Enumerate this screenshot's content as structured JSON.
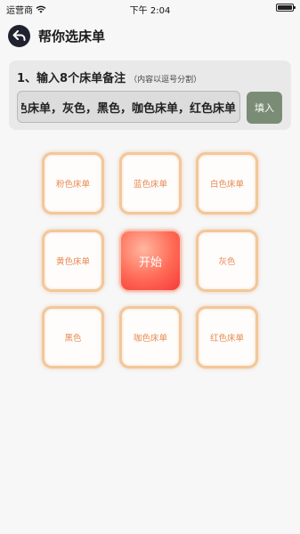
{
  "status_bar": {
    "carrier": "运营商",
    "time": "下午 2:04"
  },
  "header": {
    "title": "帮你选床单"
  },
  "input_section": {
    "heading": "1、输入8个床单备注",
    "hint": "（内容以逗号分割）",
    "value": "粉色床单，蓝色床单，白色床单，黄色床单，灰色，黑色，咖色床单，红色床单",
    "fill_button": "填入"
  },
  "grid": {
    "items": [
      "粉色床单",
      "蓝色床单",
      "白色床单",
      "黄色床单",
      "灰色",
      "黑色",
      "咖色床单",
      "红色床单"
    ],
    "start_label": "开始"
  },
  "colors": {
    "accent_orange": "#f2c79a",
    "item_text": "#e88a55",
    "fill_button": "#7a8c75",
    "start_button": "#ff6a55",
    "back_button": "#1f2330"
  }
}
